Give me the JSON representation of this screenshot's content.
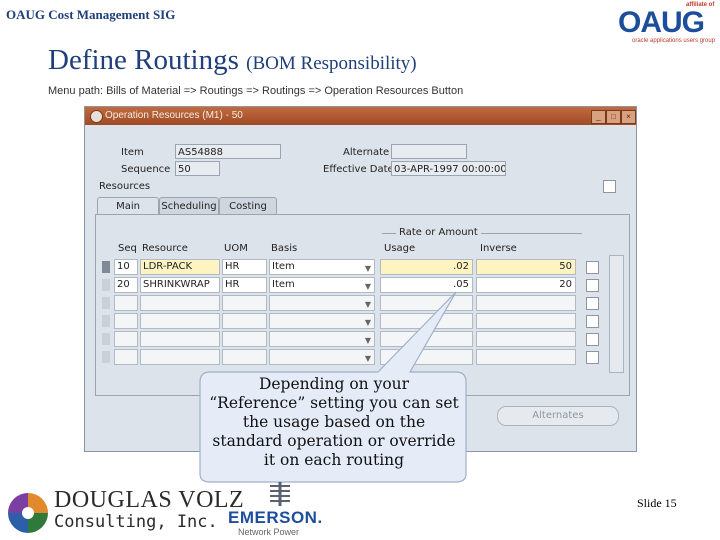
{
  "header": {
    "sig_title": "OAUG Cost Management SIG",
    "logo": {
      "letters": "OAUG",
      "affiliate": "affiliate of",
      "tagline": "oracle applications users group"
    },
    "page_title": "Define Routings",
    "page_subtitle": "(BOM Responsibility)",
    "menu_path": "Menu path:  Bills of Material => Routings => Routings => Operation Resources Button"
  },
  "window": {
    "title": "Operation Resources (M1) - 50",
    "item_label": "Item",
    "item_value": "AS54888",
    "alternate_label": "Alternate",
    "alternate_value": "",
    "sequence_label": "Sequence",
    "sequence_value": "50",
    "effective_date_label": "Effective Date",
    "effective_date_value": "03-APR-1997 00:00:00",
    "resources_label": "Resources",
    "tabs": [
      "Main",
      "Scheduling",
      "Costing"
    ],
    "active_tab": "Main",
    "rate_group_label": "Rate or Amount",
    "columns": [
      "Seq",
      "Resource",
      "UOM",
      "Basis",
      "Usage",
      "Inverse"
    ],
    "rows": [
      {
        "seq": "10",
        "resource": "LDR-PACK",
        "uom": "HR",
        "basis": "Item",
        "usage": ".02",
        "inverse": "50"
      },
      {
        "seq": "20",
        "resource": "SHRINKWRAP",
        "uom": "HR",
        "basis": "Item",
        "usage": ".05",
        "inverse": "20"
      },
      {
        "seq": "",
        "resource": "",
        "uom": "",
        "basis": "",
        "usage": "",
        "inverse": ""
      },
      {
        "seq": "",
        "resource": "",
        "uom": "",
        "basis": "",
        "usage": "",
        "inverse": ""
      },
      {
        "seq": "",
        "resource": "",
        "uom": "",
        "basis": "",
        "usage": "",
        "inverse": ""
      },
      {
        "seq": "",
        "resource": "",
        "uom": "",
        "basis": "",
        "usage": "",
        "inverse": ""
      }
    ],
    "alternates_button": "Alternates"
  },
  "callout": {
    "lines": [
      "Depending on your",
      "“Reference” setting you can set",
      "the usage based on the",
      "standard operation or override",
      "it on each routing"
    ]
  },
  "footer": {
    "company_line1": "DOUGLAS VOLZ",
    "company_line2": "Consulting, Inc.",
    "partner_name": "EMERSON.",
    "partner_sub": "Network Power",
    "slide_label": "Slide 15"
  },
  "colors": {
    "title_blue": "#1f3f7a",
    "window_bg": "#dde3ea",
    "title_bar": "#b4592f",
    "yellow_field": "#fdf4c2",
    "callout_fill": "#e5ecf8"
  }
}
